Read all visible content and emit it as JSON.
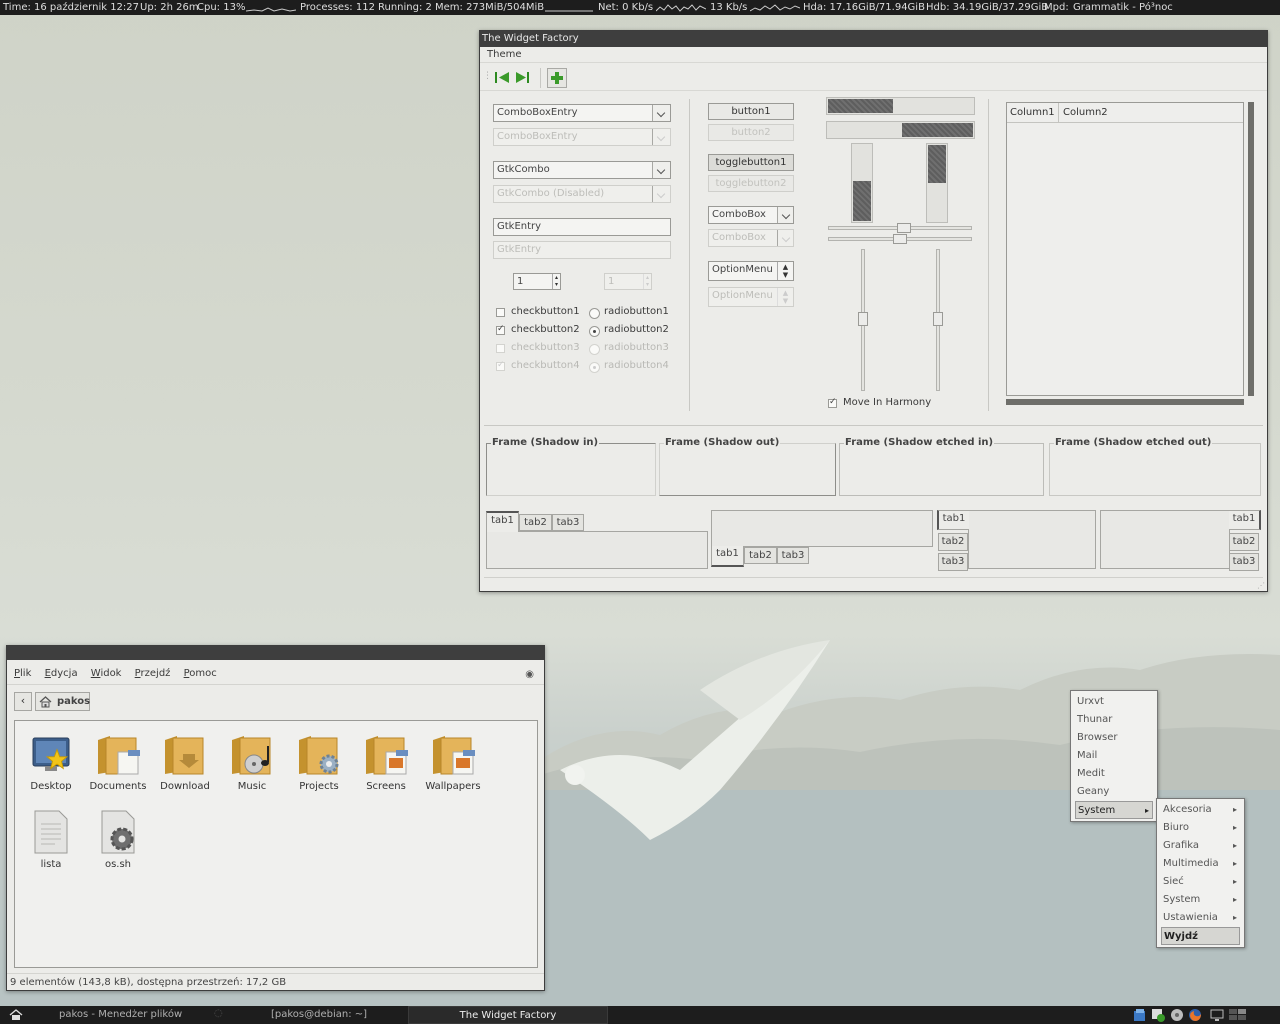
{
  "topbar": {
    "time": "Time: 16 październik 12:27",
    "up": "Up: 2h 26m",
    "cpu": "Cpu: 13%",
    "processes": "Processes: 112",
    "running": "Running: 2",
    "mem": "Mem: 273MiB/504MiB",
    "net": "Net: 0 Kb/s",
    "net2": "13 Kb/s",
    "hda": "Hda: 17.16GiB/71.94GiB",
    "hdb": "Hdb: 34.19GiB/37.29GiB",
    "mpd_label": "Mpd:",
    "mpd": "Grammatik - Pó³noc"
  },
  "widget_factory": {
    "title": "The Widget Factory",
    "menu": [
      "Theme"
    ],
    "combo_entry": "ComboBoxEntry",
    "combo_entry_disabled": "ComboBoxEntry",
    "gtk_combo": "GtkCombo",
    "gtk_combo_disabled": "GtkCombo (Disabled)",
    "entry": "GtkEntry",
    "entry_disabled": "GtkEntry",
    "spin_value": "1",
    "spin_value_disabled": "1",
    "checks": [
      "checkbutton1",
      "checkbutton2",
      "checkbutton3",
      "checkbutton4"
    ],
    "radios": [
      "radiobutton1",
      "radiobutton2",
      "radiobutton3",
      "radiobutton4"
    ],
    "button1": "button1",
    "button2": "button2",
    "toggle1": "togglebutton1",
    "toggle2": "togglebutton2",
    "combobox": "ComboBox",
    "combobox_disabled": "ComboBox",
    "optionmenu": "OptionMenu",
    "optionmenu_disabled": "OptionMenu",
    "move_in_harmony": "Move In Harmony",
    "progress_h1": 0.45,
    "progress_h2": 0.49,
    "progress_v1": 0.52,
    "progress_v2": 0.5,
    "columns": [
      "Column1",
      "Column2"
    ],
    "frames": [
      "Frame (Shadow in)",
      "Frame (Shadow out)",
      "Frame (Shadow etched in)",
      "Frame (Shadow etched out)"
    ],
    "tabs": [
      "tab1",
      "tab2",
      "tab3"
    ]
  },
  "file_manager": {
    "menu": [
      "Plik",
      "Edycja",
      "Widok",
      "Przejdź",
      "Pomoc"
    ],
    "location": "pakos",
    "items": [
      {
        "name": "Desktop",
        "icon": "desktop-folder-icon"
      },
      {
        "name": "Documents",
        "icon": "documents-folder-icon"
      },
      {
        "name": "Download",
        "icon": "download-folder-icon"
      },
      {
        "name": "Music",
        "icon": "music-folder-icon"
      },
      {
        "name": "Projects",
        "icon": "projects-folder-icon"
      },
      {
        "name": "Screens",
        "icon": "screens-folder-icon"
      },
      {
        "name": "Wallpapers",
        "icon": "wallpapers-folder-icon"
      },
      {
        "name": "lista",
        "icon": "text-file-icon"
      },
      {
        "name": "os.sh",
        "icon": "script-file-icon"
      }
    ],
    "status": "9 elementów (143,8 kB), dostępna przestrzeń: 17,2 GB"
  },
  "app_menu": {
    "items": [
      "Urxvt",
      "Thunar",
      "Browser",
      "Mail",
      "Medit",
      "Geany",
      "System"
    ],
    "submenu": [
      "Akcesoria",
      "Biuro",
      "Grafika",
      "Multimedia",
      "Sieć",
      "System",
      "Ustawienia",
      "Wyjdź"
    ]
  },
  "taskbar": {
    "tasks": [
      "pakos - Menedżer plików",
      "[pakos@debian: ~]",
      "The Widget Factory"
    ]
  },
  "colors": {
    "accent_green": "#3a9a2a",
    "dark_bar": "#1d1d1d"
  }
}
